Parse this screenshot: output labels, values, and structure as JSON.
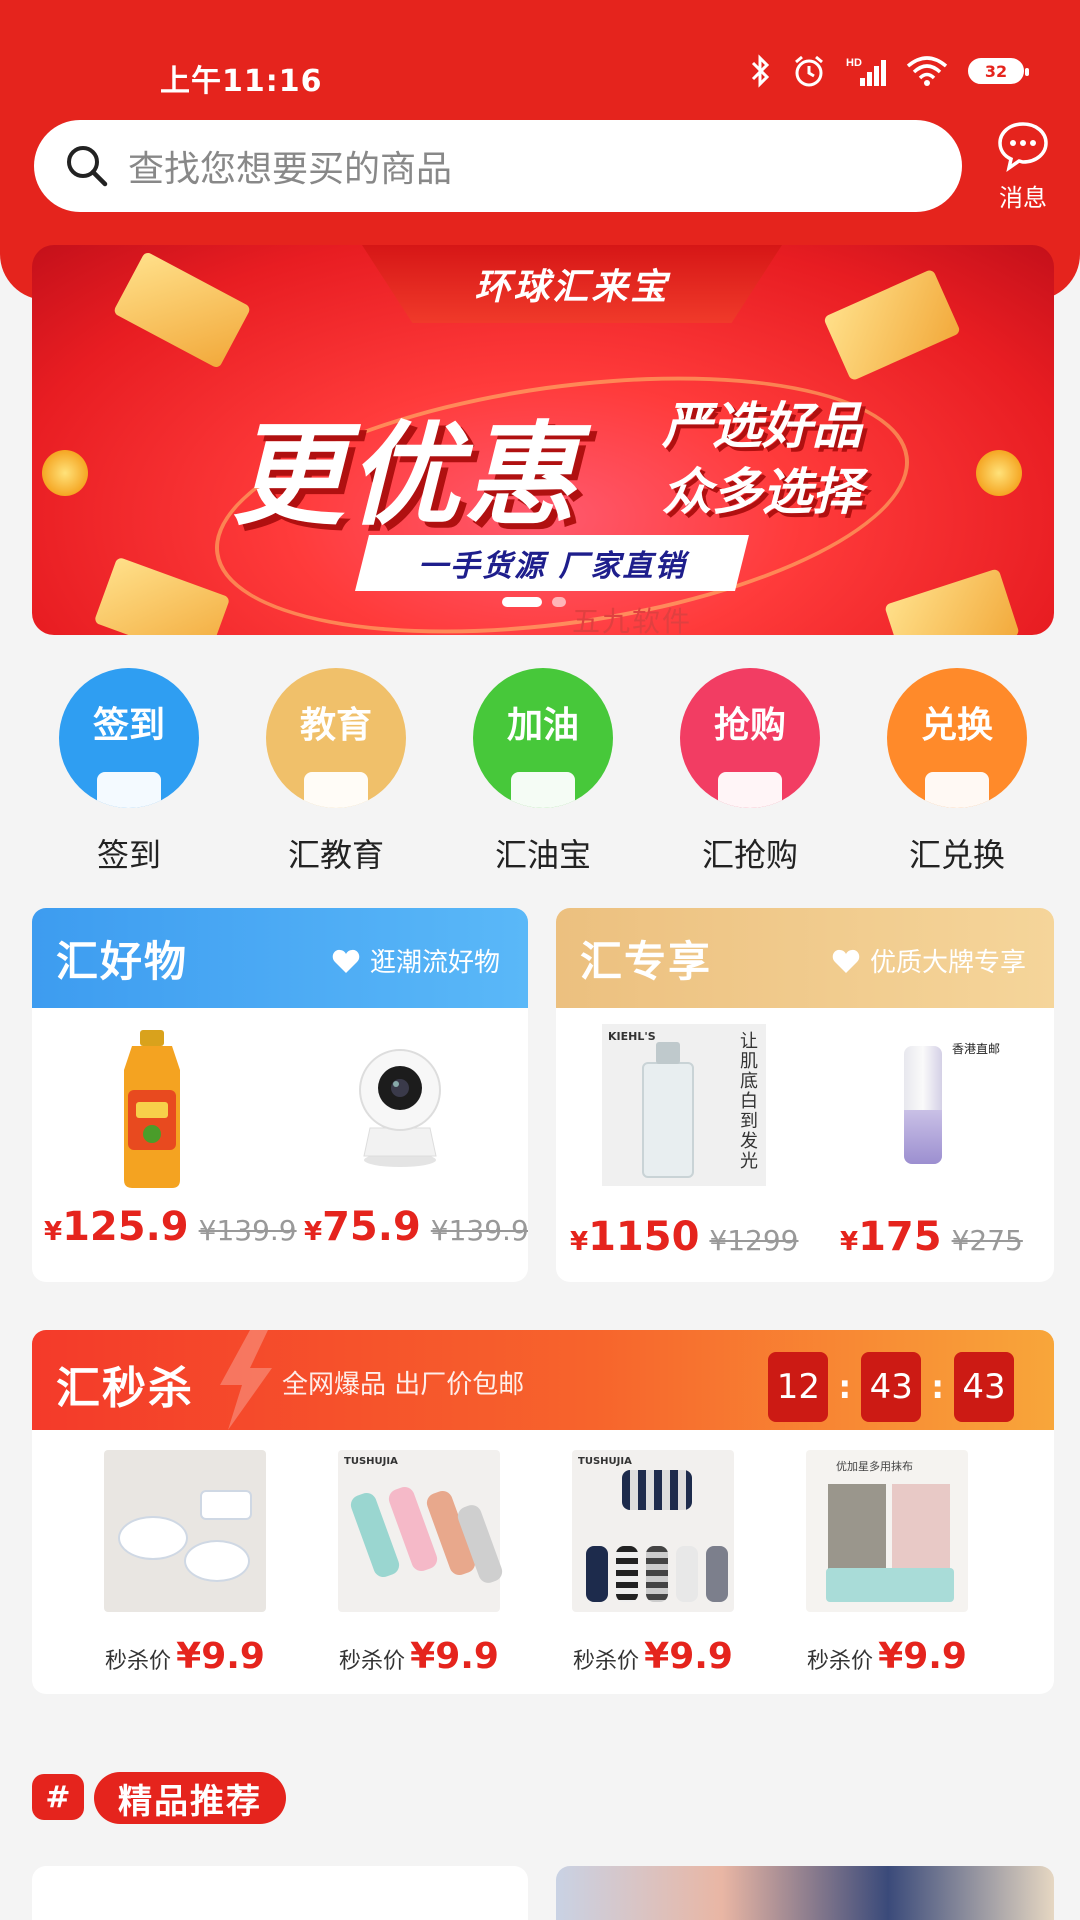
{
  "status_bar": {
    "time": "上午11:16",
    "battery": "32"
  },
  "search": {
    "placeholder": "查找您想要买的商品"
  },
  "message": {
    "label": "消息"
  },
  "banner": {
    "top_label": "环球汇来宝",
    "headline": "更优惠",
    "sub_line1": "严选好品",
    "sub_line2": "众多选择",
    "strip_text": "一手货源  厂家直销"
  },
  "watermark": "五九软件",
  "quick_menu": [
    {
      "title": "签到",
      "label": "签到",
      "color": "#2f9ef2"
    },
    {
      "title": "教育",
      "label": "汇教育",
      "color": "#f0c06a"
    },
    {
      "title": "加油",
      "label": "汇油宝",
      "color": "#47c83a"
    },
    {
      "title": "抢购",
      "label": "汇抢购",
      "color": "#f23d63"
    },
    {
      "title": "兑换",
      "label": "汇兑换",
      "color": "#ff8a2a"
    }
  ],
  "good_things": {
    "title": "汇好物",
    "tag": "逛潮流好物",
    "products": [
      {
        "icon": "oil-bottle-image",
        "price": "125.9",
        "old_price": "¥139.9"
      },
      {
        "icon": "camera-image",
        "price": "75.9",
        "old_price": "¥139.9"
      }
    ]
  },
  "exclusive": {
    "title": "汇专享",
    "tag": "优质大牌专享",
    "products": [
      {
        "icon": "toner-bottle-image",
        "image_text": "让肌底白到发光",
        "brand_text": "KIEHL'S",
        "price": "1150",
        "old_price": "¥1299"
      },
      {
        "icon": "serum-bottle-image",
        "image_text": "香港直邮",
        "price": "175",
        "old_price": "¥275"
      }
    ]
  },
  "flash_sale": {
    "title": "汇秒杀",
    "subtitle": "全网爆品 出厂价包邮",
    "countdown": [
      "12",
      "43",
      "43"
    ],
    "price_label": "秒杀价",
    "items": [
      {
        "icon": "tableware-image",
        "price": "¥9.9"
      },
      {
        "icon": "socks-image",
        "brand_text": "TUSHUJIA",
        "price": "¥9.9"
      },
      {
        "icon": "socks-image",
        "brand_text": "TUSHUJIA",
        "price": "¥9.9"
      },
      {
        "icon": "towel-image",
        "image_text": "优加星多用抹布",
        "price": "¥9.9"
      }
    ]
  },
  "recommend": {
    "hash": "#",
    "title": "精品推荐"
  },
  "colors": {
    "brand_red": "#e5241d",
    "blue_header": "#2f9ef2",
    "gold_header": "#f0c98a"
  }
}
